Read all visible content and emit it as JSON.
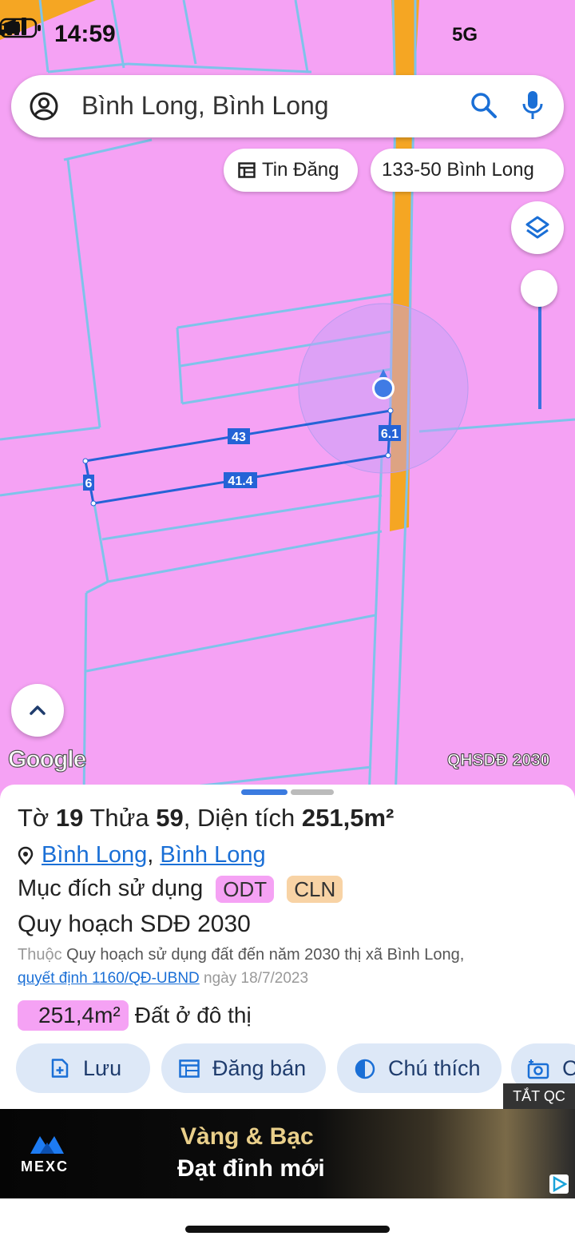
{
  "status_bar": {
    "time": "14:59",
    "network": "5G"
  },
  "search": {
    "text": "Bình Long, Bình Long"
  },
  "chips": {
    "listing": "Tin Đăng",
    "place": "133-50 Bình Long"
  },
  "map": {
    "edge_labels": {
      "top": "43",
      "bottom": "41.4",
      "left": "6",
      "right": "6.1"
    },
    "google_logo": "Google",
    "layer_name": "QHSDĐ 2030"
  },
  "sheet": {
    "title": {
      "sheet_word": "Tờ",
      "sheet_no": "19",
      "parcel_word": "Thửa",
      "parcel_no": "59",
      "area_word": ", Diện tích",
      "area": "251,5m²"
    },
    "location": {
      "ward": "Bình Long",
      "sep": ",",
      "town": "Bình Long"
    },
    "purpose": {
      "label": "Mục đích sử dụng",
      "tags": [
        "ODT",
        "CLN"
      ]
    },
    "plan": "Quy hoạch SDĐ 2030",
    "belongs": {
      "prefix": "Thuộc",
      "text": "Quy hoạch sử dụng đất đến năm 2030 thị xã Bình Long,"
    },
    "decision": {
      "link": "quyết định 1160/QĐ-UBND",
      "date": "ngày 18/7/2023"
    },
    "area_detail": {
      "value": "251,4m²",
      "label": "Đất ở đô thị"
    },
    "buttons": {
      "save": "Lưu",
      "post": "Đăng bán",
      "legend": "Chú thích",
      "capture": "C"
    }
  },
  "ad": {
    "close": "TẮT QC",
    "brand": "MEXC",
    "line1": "Vàng & Bạc",
    "line2": "Đạt đỉnh mới"
  },
  "colors": {
    "land_pink": "#f5a2f4",
    "road_orange": "#f5a623",
    "parcel_blue": "#2563d6",
    "accent": "#1a6fd6"
  }
}
